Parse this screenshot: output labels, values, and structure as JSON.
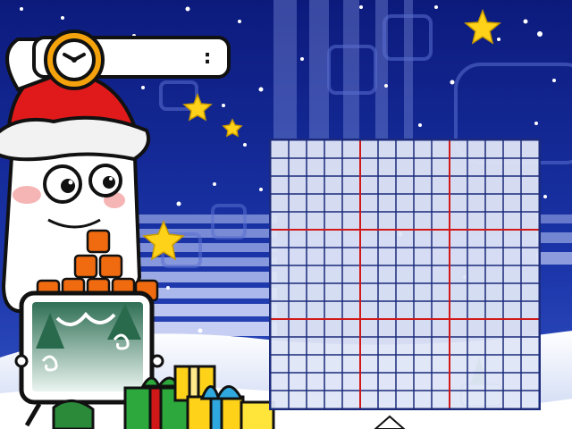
{
  "timer": {
    "display": ":"
  },
  "colors": {
    "sky": "#0d1f86",
    "stripe": "#9aa9e6",
    "grid_line": "#1b2a7a",
    "grid_major": "#d01818",
    "grid_fill": "#dfe6f7",
    "hat_red": "#e01a1a",
    "block_orange": "#f06a10",
    "star_yellow": "#ffd21a",
    "snow": "#ffffff"
  },
  "icons": {
    "clock": "clock-icon",
    "mascot": "pencil-mascot",
    "preview": "tree-preview-frame",
    "tiles": "orange-block-stack",
    "gifts": "gift-boxes"
  },
  "grid": {
    "rows": 15,
    "cols": 15,
    "major_every": 5
  }
}
